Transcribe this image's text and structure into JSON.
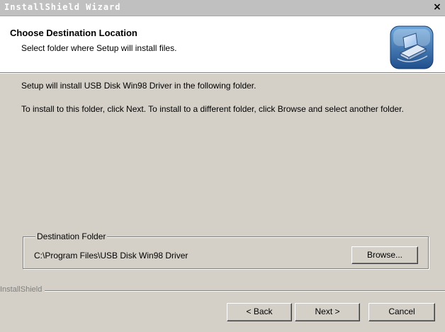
{
  "window": {
    "title": "InstallShield Wizard",
    "close_glyph": "×"
  },
  "header": {
    "title": "Choose Destination Location",
    "subtitle": "Select folder where Setup will install files.",
    "icon": "computer-install-icon"
  },
  "body": {
    "line1": "Setup will install USB Disk Win98 Driver in the following folder.",
    "line2": "To install to this folder, click Next. To install to a different folder, click Browse and select another folder."
  },
  "destination": {
    "legend": "Destination Folder",
    "path": "C:\\Program Files\\USB Disk Win98 Driver",
    "browse_label": "Browse..."
  },
  "footer": {
    "brand": "InstallShield",
    "back_label": "< Back",
    "next_label": "Next >",
    "cancel_label": "Cancel"
  },
  "colors": {
    "dialog_bg": "#d4d0c8",
    "header_bg": "#ffffff",
    "titlebar_bg": "#c0c0c0"
  }
}
